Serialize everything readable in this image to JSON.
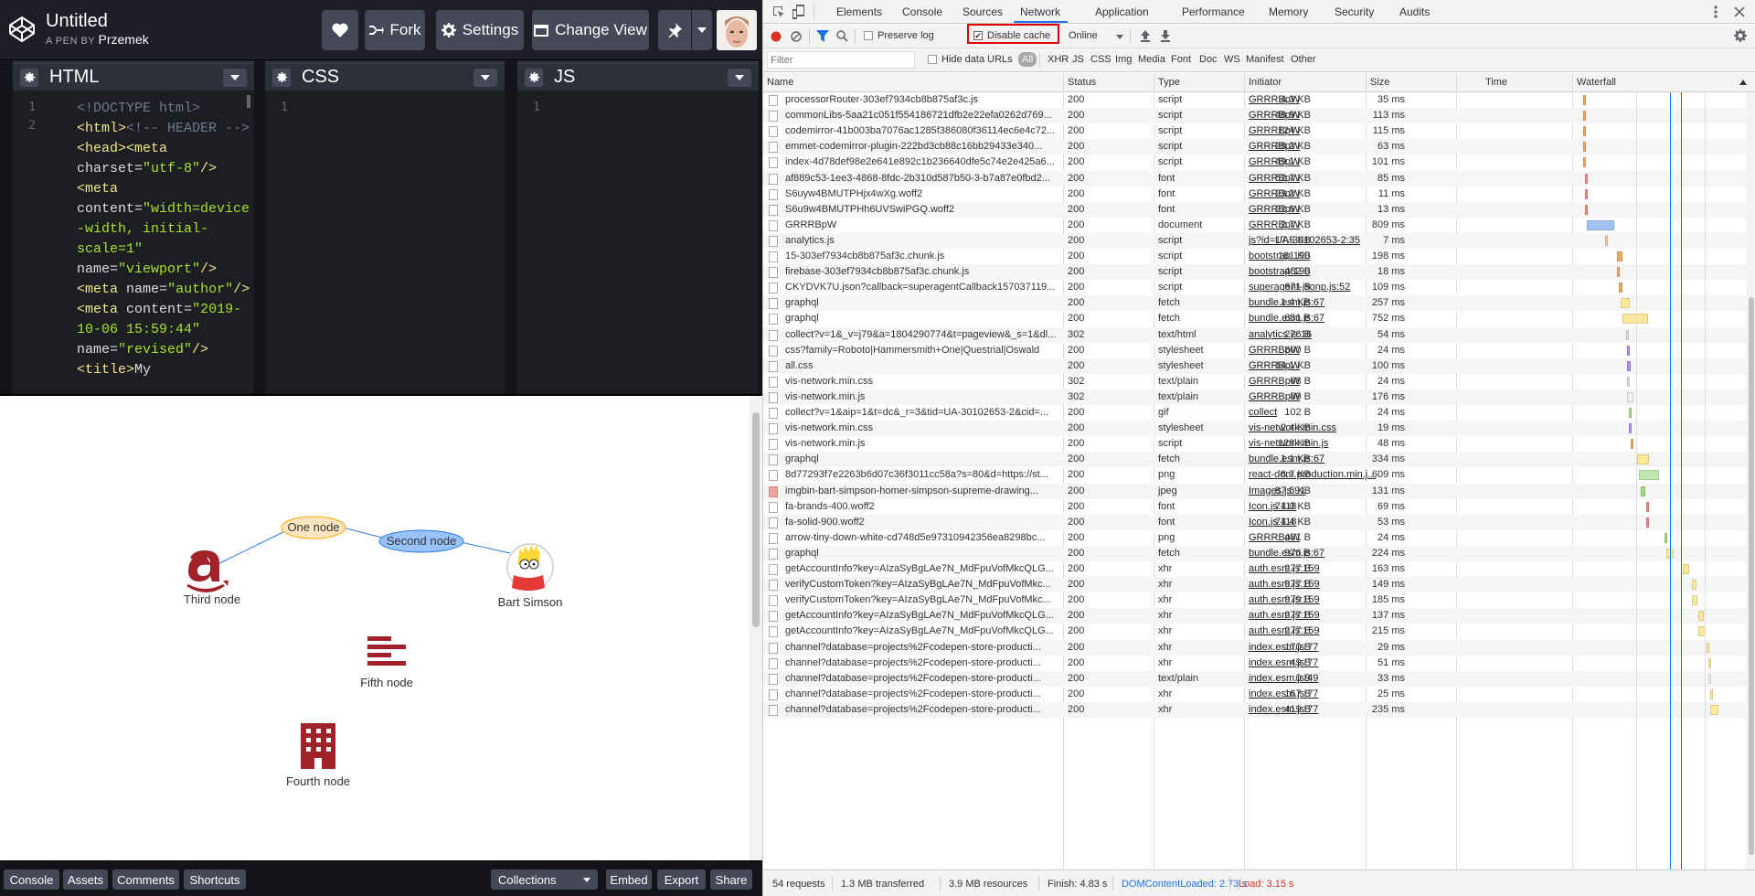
{
  "header": {
    "title": "Untitled",
    "by_prefix": "A PEN BY",
    "author": "Przemek",
    "fork": "Fork",
    "settings": "Settings",
    "change_view": "Change View"
  },
  "editors": {
    "html": "HTML",
    "css": "CSS",
    "js": "JS",
    "html_gutter": [
      "1",
      "2"
    ],
    "css_gutter": "1",
    "js_gutter": "1"
  },
  "result": {
    "nodes": {
      "one": "One node",
      "second": "Second node",
      "third": "Third node",
      "bart": "Bart Simson",
      "fifth": "Fifth node",
      "fourth": "Fourth node"
    }
  },
  "footer": {
    "console": "Console",
    "assets": "Assets",
    "comments": "Comments",
    "shortcuts": "Shortcuts",
    "collections": "Collections",
    "embed": "Embed",
    "export": "Export",
    "share": "Share"
  },
  "devtools": {
    "tabs": [
      "Elements",
      "Console",
      "Sources",
      "Network",
      "Application",
      "Performance",
      "Memory",
      "Security",
      "Audits"
    ],
    "preserve_log": "Preserve log",
    "disable_cache": "Disable cache",
    "throttle": "Online",
    "filter_placeholder": "Filter",
    "hide_data_urls": "Hide data URLs",
    "filters": [
      "All",
      "XHR",
      "JS",
      "CSS",
      "Img",
      "Media",
      "Font",
      "Doc",
      "WS",
      "Manifest",
      "Other"
    ],
    "columns": [
      "Name",
      "Status",
      "Type",
      "Initiator",
      "Size",
      "Time",
      "Waterfall"
    ],
    "status": {
      "requests": "54 requests",
      "transferred": "1.3 MB transferred",
      "resources": "3.9 MB resources",
      "finish": "Finish: 4.83 s",
      "dcl": "DOMContentLoaded: 2.73 s",
      "load": "Load: 3.15 s"
    },
    "rows": [
      {
        "name": "processorRouter-303ef7934cb8b875af3c.js",
        "status": "200",
        "type": "script",
        "init": "GRRRBpW",
        "size": "4.3 KB",
        "time": "35 ms",
        "wf": {
          "s": 0.05,
          "w": 0.012,
          "c": "#f0a868"
        }
      },
      {
        "name": "commonLibs-5aa21c051f554186721dfb2e22efa0262d769...",
        "status": "200",
        "type": "script",
        "init": "GRRRBpW",
        "size": "48.9 KB",
        "time": "113 ms",
        "wf": {
          "s": 0.05,
          "w": 0.015,
          "c": "#f0a868"
        }
      },
      {
        "name": "codemirror-41b003ba7076ac1285f386080f36114ec6e4c72...",
        "status": "200",
        "type": "script",
        "init": "GRRRBpW",
        "size": "124 KB",
        "time": "115 ms",
        "wf": {
          "s": 0.05,
          "w": 0.015,
          "c": "#f0a868"
        }
      },
      {
        "name": "emmet-codemirror-plugin-222bd3cb88c16bb29433e340...",
        "status": "200",
        "type": "script",
        "init": "GRRRBpW",
        "size": "28.2 KB",
        "time": "63 ms",
        "wf": {
          "s": 0.05,
          "w": 0.012,
          "c": "#f0a868"
        }
      },
      {
        "name": "index-4d78def98e2e641e892c1b236640dfe5c74e2e425a6...",
        "status": "200",
        "type": "script",
        "init": "GRRRBpW",
        "size": "49.1 KB",
        "time": "101 ms",
        "wf": {
          "s": 0.05,
          "w": 0.014,
          "c": "#f0a868"
        }
      },
      {
        "name": "af889c53-1ee3-4868-8fdc-2b310d587b50-3-b7a87e0fbd2...",
        "status": "200",
        "type": "font",
        "init": "GRRRBpW",
        "size": "52.7 KB",
        "time": "85 ms",
        "wf": {
          "s": 0.06,
          "w": 0.013,
          "c": "#e88"
        }
      },
      {
        "name": "S6uyw4BMUTPHjx4wXg.woff2",
        "status": "200",
        "type": "font",
        "init": "GRRRBpW",
        "size": "23.2 KB",
        "time": "11 ms",
        "wf": {
          "s": 0.06,
          "w": 0.008,
          "c": "#e88"
        }
      },
      {
        "name": "S6u9w4BMUTPHh6UVSwiPGQ.woff2",
        "status": "200",
        "type": "font",
        "init": "GRRRBpW",
        "size": "22.6 KB",
        "time": "13 ms",
        "wf": {
          "s": 0.06,
          "w": 0.008,
          "c": "#e88"
        }
      },
      {
        "name": "GRRRBpW",
        "status": "200",
        "type": "document",
        "init": "GRRRBpW",
        "size": "2.7 KB",
        "time": "809 ms",
        "wf": {
          "s": 0.07,
          "w": 0.16,
          "c": "#9ec2f5"
        }
      },
      {
        "name": "analytics.js",
        "status": "200",
        "type": "script",
        "init": "js?id=UA-30102653-2:35",
        "size": "17.5 KB",
        "time": "7 ms",
        "wf": {
          "s": 0.18,
          "w": 0.01,
          "c": "#f0c8a0"
        }
      },
      {
        "name": "15-303ef7934cb8b875af3c.chunk.js",
        "status": "200",
        "type": "script",
        "init": "bootstrap:190",
        "size": "181 KB",
        "time": "198 ms",
        "wf": {
          "s": 0.25,
          "w": 0.03,
          "c": "#f0a868"
        }
      },
      {
        "name": "firebase-303ef7934cb8b875af3c.chunk.js",
        "status": "200",
        "type": "script",
        "init": "bootstrap:190",
        "size": "482 B",
        "time": "18 ms",
        "wf": {
          "s": 0.25,
          "w": 0.012,
          "c": "#f0a868"
        }
      },
      {
        "name": "CKYDVK7U.json?callback=superagentCallback157037119...",
        "status": "200",
        "type": "script",
        "init": "superagent-jsonp.js:52",
        "size": "671 B",
        "time": "109 ms",
        "wf": {
          "s": 0.26,
          "w": 0.02,
          "c": "#f0a868"
        }
      },
      {
        "name": "graphql",
        "status": "200",
        "type": "fetch",
        "init": "bundle.esm.js:67",
        "size": "1.4 KB",
        "time": "257 ms",
        "wf": {
          "s": 0.27,
          "w": 0.055,
          "c": "#fbe89a"
        }
      },
      {
        "name": "graphql",
        "status": "200",
        "type": "fetch",
        "init": "bundle.esm.js:67",
        "size": "651 B",
        "time": "752 ms",
        "wf": {
          "s": 0.28,
          "w": 0.15,
          "c": "#fbe89a"
        }
      },
      {
        "name": "collect?v=1&_v=j79&a=1804290774&t=pageview&_s=1&dl...",
        "status": "302",
        "type": "text/html",
        "init": "analytics.js:16",
        "size": "276 B",
        "time": "54 ms",
        "wf": {
          "s": 0.3,
          "w": 0.015,
          "c": "#ddd"
        }
      },
      {
        "name": "css?family=Roboto|Hammersmith+One|Questrial|Oswald",
        "status": "200",
        "type": "stylesheet",
        "init": "GRRRBpW",
        "size": "800 B",
        "time": "24 ms",
        "wf": {
          "s": 0.31,
          "w": 0.01,
          "c": "#b48cf0"
        }
      },
      {
        "name": "all.css",
        "status": "200",
        "type": "stylesheet",
        "init": "GRRRBpW",
        "size": "14.1 KB",
        "time": "100 ms",
        "wf": {
          "s": 0.31,
          "w": 0.02,
          "c": "#b48cf0"
        }
      },
      {
        "name": "vis-network.min.css",
        "status": "302",
        "type": "text/plain",
        "init": "GRRRBpW",
        "size": "68 B",
        "time": "24 ms",
        "wf": {
          "s": 0.31,
          "w": 0.01,
          "c": "#ddd"
        }
      },
      {
        "name": "vis-network.min.js",
        "status": "302",
        "type": "text/plain",
        "init": "GRRRBpW",
        "size": "89 B",
        "time": "176 ms",
        "wf": {
          "s": 0.31,
          "w": 0.035,
          "c": "#eee"
        }
      },
      {
        "name": "collect?v=1&aip=1&t=dc&_r=3&tid=UA-30102653-2&cid=...",
        "status": "200",
        "type": "gif",
        "init": "collect",
        "size": "102 B",
        "time": "24 ms",
        "wf": {
          "s": 0.32,
          "w": 0.012,
          "c": "#9fd88a"
        }
      },
      {
        "name": "vis-network.min.css",
        "status": "200",
        "type": "stylesheet",
        "init": "vis-network.min.css",
        "size": "2.4 KB",
        "time": "19 ms",
        "wf": {
          "s": 0.32,
          "w": 0.01,
          "c": "#b48cf0"
        }
      },
      {
        "name": "vis-network.min.js",
        "status": "200",
        "type": "script",
        "init": "vis-network.min.js",
        "size": "128 KB",
        "time": "48 ms",
        "wf": {
          "s": 0.33,
          "w": 0.013,
          "c": "#f0a868"
        }
      },
      {
        "name": "graphql",
        "status": "200",
        "type": "fetch",
        "init": "bundle.esm.js:67",
        "size": "1.1 KB",
        "time": "334 ms",
        "wf": {
          "s": 0.37,
          "w": 0.07,
          "c": "#fbe89a"
        }
      },
      {
        "name": "8d77293f7e2263b6d07c36f3011cc58a?s=80&d=https://st...",
        "status": "200",
        "type": "png",
        "init": "react-dom.production.min.j...",
        "size": "8.7 KB",
        "time": "609 ms",
        "wf": {
          "s": 0.38,
          "w": 0.12,
          "c": "#bfe8b0"
        }
      },
      {
        "name": "imgbin-bart-simpson-homer-simpson-supreme-drawing...",
        "status": "200",
        "type": "jpeg",
        "init": "Images.js:91",
        "size": "87.5 KB",
        "time": "131 ms",
        "wf": {
          "s": 0.39,
          "w": 0.028,
          "c": "#9fd88a"
        },
        "img": true
      },
      {
        "name": "fa-brands-400.woff2",
        "status": "200",
        "type": "font",
        "init": "Icon.js:118",
        "size": "74.0 KB",
        "time": "69 ms",
        "wf": {
          "s": 0.42,
          "w": 0.015,
          "c": "#e88"
        }
      },
      {
        "name": "fa-solid-900.woff2",
        "status": "200",
        "type": "font",
        "init": "Icon.js:118",
        "size": "74.4 KB",
        "time": "53 ms",
        "wf": {
          "s": 0.42,
          "w": 0.013,
          "c": "#e88"
        }
      },
      {
        "name": "arrow-tiny-down-white-cd748d5e97310942356ea8298bc...",
        "status": "200",
        "type": "png",
        "init": "GRRRBpW",
        "size": "481 B",
        "time": "24 ms",
        "wf": {
          "s": 0.53,
          "w": 0.01,
          "c": "#9fd88a"
        }
      },
      {
        "name": "graphql",
        "status": "200",
        "type": "fetch",
        "init": "bundle.esm.js:67",
        "size": "976 B",
        "time": "224 ms",
        "wf": {
          "s": 0.54,
          "w": 0.045,
          "c": "#fbe89a"
        }
      },
      {
        "name": "getAccountInfo?key=AIzaSyBgLAe7N_MdFpuVofMkcQLG...",
        "status": "200",
        "type": "xhr",
        "init": "auth.esm.js:159",
        "size": "277 B",
        "time": "163 ms",
        "wf": {
          "s": 0.64,
          "w": 0.035,
          "c": "#fbe89a"
        }
      },
      {
        "name": "verifyCustomToken?key=AIzaSyBgLAe7N_MdFpuVofMkc...",
        "status": "200",
        "type": "xhr",
        "init": "auth.esm.js:159",
        "size": "977 B",
        "time": "149 ms",
        "wf": {
          "s": 0.69,
          "w": 0.03,
          "c": "#fbe89a"
        }
      },
      {
        "name": "verifyCustomToken?key=AIzaSyBgLAe7N_MdFpuVofMkc...",
        "status": "200",
        "type": "xhr",
        "init": "auth.esm.js:159",
        "size": "979 B",
        "time": "185 ms",
        "wf": {
          "s": 0.69,
          "w": 0.036,
          "c": "#fbe89a"
        }
      },
      {
        "name": "getAccountInfo?key=AIzaSyBgLAe7N_MdFpuVofMkcQLG...",
        "status": "200",
        "type": "xhr",
        "init": "auth.esm.js:159",
        "size": "277 B",
        "time": "137 ms",
        "wf": {
          "s": 0.73,
          "w": 0.03,
          "c": "#fbe89a"
        }
      },
      {
        "name": "getAccountInfo?key=AIzaSyBgLAe7N_MdFpuVofMkcQLG...",
        "status": "200",
        "type": "xhr",
        "init": "auth.esm.js:159",
        "size": "277 B",
        "time": "215 ms",
        "wf": {
          "s": 0.73,
          "w": 0.045,
          "c": "#fbe89a"
        }
      },
      {
        "name": "channel?database=projects%2Fcodepen-store-producti...",
        "status": "200",
        "type": "xhr",
        "init": "index.esm.js:77",
        "size": "170 B",
        "time": "29 ms",
        "wf": {
          "s": 0.78,
          "w": 0.01,
          "c": "#fbe89a"
        }
      },
      {
        "name": "channel?database=projects%2Fcodepen-store-producti...",
        "status": "200",
        "type": "xhr",
        "init": "index.esm.js:77",
        "size": "49 B",
        "time": "51 ms",
        "wf": {
          "s": 0.79,
          "w": 0.012,
          "c": "#fbe89a"
        }
      },
      {
        "name": "channel?database=projects%2Fcodepen-store-producti...",
        "status": "200",
        "type": "text/plain",
        "init": "index.esm.js:49",
        "size": "0 B",
        "time": "33 ms",
        "wf": {
          "s": 0.79,
          "w": 0.01,
          "c": "#eee"
        }
      },
      {
        "name": "channel?database=projects%2Fcodepen-store-producti...",
        "status": "200",
        "type": "xhr",
        "init": "index.esm.js:77",
        "size": "167 B",
        "time": "25 ms",
        "wf": {
          "s": 0.8,
          "w": 0.01,
          "c": "#fbe89a"
        }
      },
      {
        "name": "channel?database=projects%2Fcodepen-store-producti...",
        "status": "200",
        "type": "xhr",
        "init": "index.esm.js:77",
        "size": "419 B",
        "time": "235 ms",
        "wf": {
          "s": 0.8,
          "w": 0.05,
          "c": "#fbe89a"
        }
      }
    ]
  },
  "colors": {
    "codepen_bg": "#1e1f26",
    "highlight": "#e00000",
    "dcl": "#1a73e8",
    "load": "#d93025"
  }
}
